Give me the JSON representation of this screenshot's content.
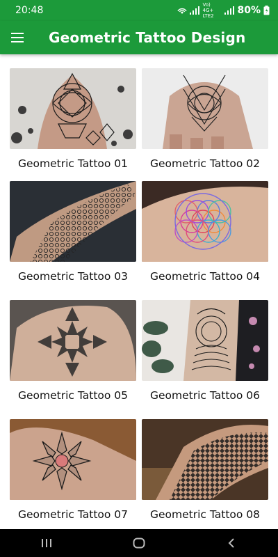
{
  "status_bar": {
    "time": "20:48",
    "network": "Vo) 4G+ LTE2",
    "battery": "80%"
  },
  "app_bar": {
    "title": "Geometric Tattoo Design",
    "menu_icon": "hamburger-menu-icon"
  },
  "colors": {
    "primary": "#1c9a3a",
    "nav_bar": "#000000"
  },
  "items": [
    {
      "label": "Geometric Tattoo 01"
    },
    {
      "label": "Geometric Tattoo 02"
    },
    {
      "label": "Geometric Tattoo 03"
    },
    {
      "label": "Geometric Tattoo 04"
    },
    {
      "label": "Geometric Tattoo 05"
    },
    {
      "label": "Geometric Tattoo 06"
    },
    {
      "label": "Geometric Tattoo 07"
    },
    {
      "label": "Geometric Tattoo 08"
    }
  ],
  "nav": {
    "recents_icon": "recents-icon",
    "home_icon": "home-icon",
    "back_icon": "back-icon"
  }
}
